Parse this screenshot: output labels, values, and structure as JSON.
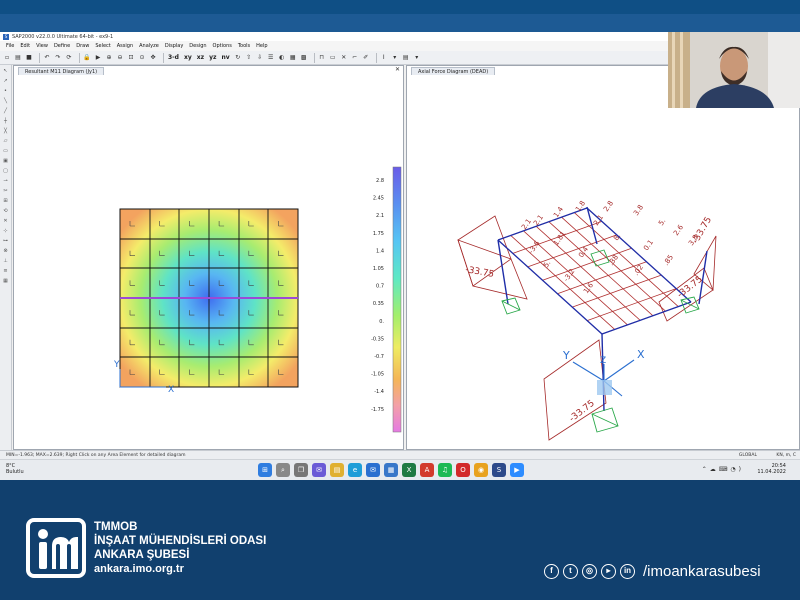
{
  "app": {
    "title": "SAP2000 v22.0.0 Ultimate 64-bit - ex9-1",
    "menu": [
      "File",
      "Edit",
      "View",
      "Define",
      "Draw",
      "Select",
      "Assign",
      "Analyze",
      "Display",
      "Design",
      "Options",
      "Tools",
      "Help"
    ],
    "toolbar_text": [
      "3-d",
      "xy",
      "xz",
      "yz",
      "nv"
    ]
  },
  "left_pane": {
    "tab": "Resultant M11 Diagram (Jy1)",
    "legend": [
      "2.8",
      "2.45",
      "2.1",
      "1.75",
      "1.4",
      "1.05",
      "0.7",
      "0.35",
      "0.",
      "-0.35",
      "-0.7",
      "-1.05",
      "-1.4",
      "-1.75"
    ],
    "axis_x": "X",
    "axis_y": "Y"
  },
  "right_pane": {
    "tab": "Axial Force Diagram (DEAD)",
    "labels": [
      "-33.75",
      "-33.75",
      "-33.75",
      "-33.75"
    ],
    "small_labels": [
      "2.1",
      "2.1",
      "1.4",
      "1.8",
      "2.8",
      "3.8",
      "5.",
      "2.6",
      "3.8",
      "-3.6",
      "5.",
      "-3.2",
      "1.6",
      "1.81",
      "0.4",
      ".38",
      ".02",
      ".85",
      "8.",
      "0.1",
      "2.1"
    ],
    "axis": [
      "X",
      "Y",
      "Z"
    ]
  },
  "status": {
    "text": "MIN=-1.963; MAX=2.639; Right Click on any Area Element for detailed diagram",
    "coord_system": "GLOBAL",
    "units": "KN, m, C"
  },
  "taskbar": {
    "weather_temp": "8°C",
    "weather_desc": "Bulutlu",
    "time": "20:54",
    "date": "11.04.2022"
  },
  "footer": {
    "line1": "TMMOB",
    "line2": "İNŞAAT MÜHENDİSLERİ ODASI",
    "line3": "ANKARA ŞUBESİ",
    "website": "ankara.imo.org.tr",
    "social_handle": "/imoankarasubesi",
    "social_icons": [
      "facebook-icon",
      "twitter-icon",
      "instagram-icon",
      "youtube-icon",
      "linkedin-icon"
    ]
  },
  "colors": {
    "footer_bg": "#11406e",
    "frame_red": "#a52a2a",
    "frame_blue": "#1f2ea8",
    "axis_blue": "#2a6fd0"
  }
}
